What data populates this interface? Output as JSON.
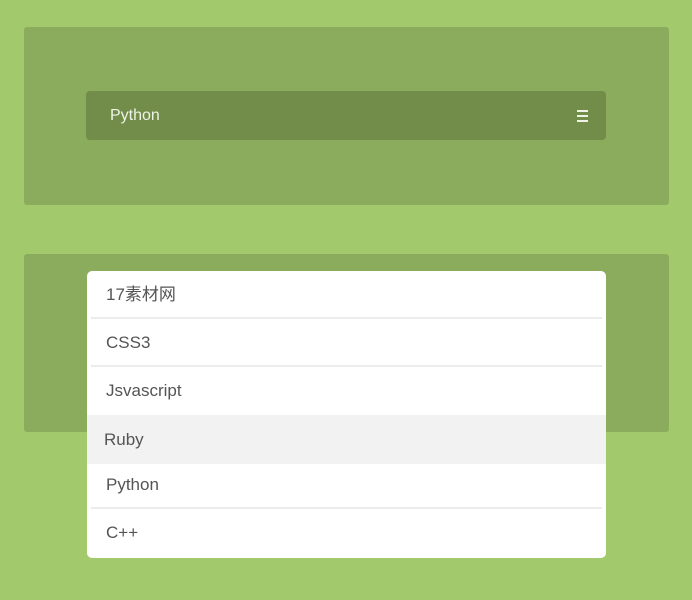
{
  "select_one": {
    "selected_value": "Python",
    "toggle_icon": "menu-icon"
  },
  "select_two": {
    "options": [
      {
        "label": "17素材网"
      },
      {
        "label": "CSS3"
      },
      {
        "label": "Jsvascript"
      },
      {
        "label": "Ruby"
      },
      {
        "label": "Python"
      },
      {
        "label": "C++"
      }
    ],
    "highlighted_option": "Ruby"
  },
  "colors": {
    "page_background": "#a2c96c",
    "panel_background": "#8bac5c",
    "select_background": "#728d4a",
    "dropdown_background": "#ffffff",
    "option_hover_background": "#f2f2f2",
    "option_text": "#555555"
  }
}
